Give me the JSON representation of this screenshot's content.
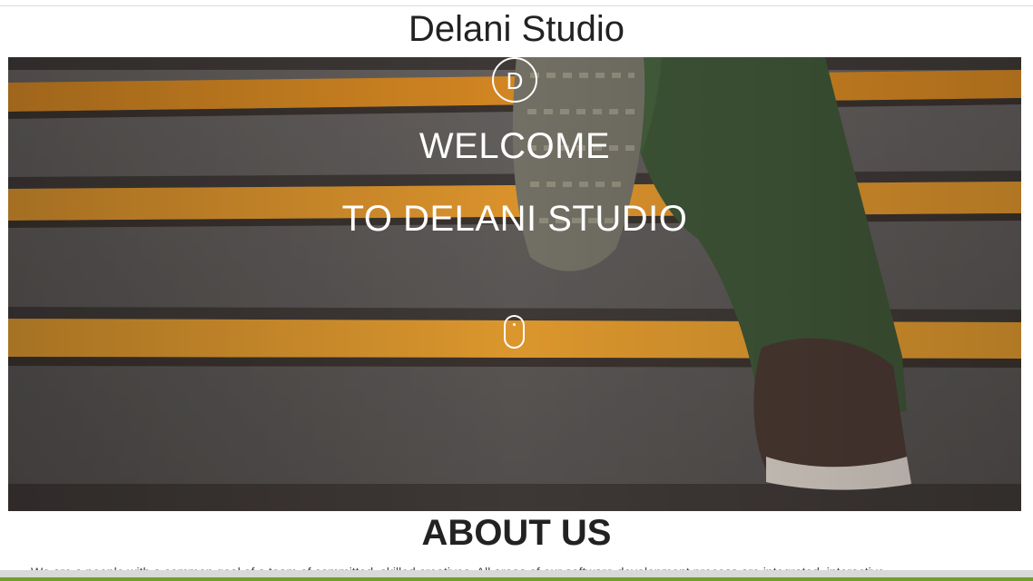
{
  "site": {
    "title": "Delani Studio"
  },
  "hero": {
    "logo_letter": "D",
    "line1": "WELCOME",
    "line2": "TO DELANI STUDIO",
    "scroll_icon": "mouse-scroll-icon"
  },
  "about": {
    "title": "ABOUT US",
    "text": "We are a people with a common goal of a team of committed, skilled creatives. All areas of our software development process are integrated, interactive"
  },
  "colors": {
    "background": "#ffffff",
    "hero_text": "#ffffff",
    "stripe_orange": "#e8931f",
    "footer_accent": "#6fa028"
  }
}
